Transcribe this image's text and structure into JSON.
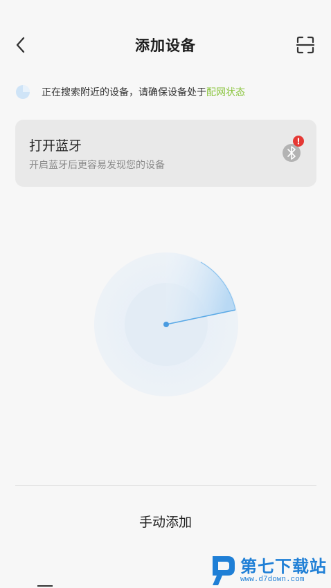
{
  "header": {
    "title": "添加设备",
    "back_icon": "chevron-left-icon",
    "scan_icon": "scan-icon"
  },
  "status": {
    "text": "正在搜索附近的设备，请确保设备处于",
    "link_text": "配网状态",
    "link_color": "#8bc53f",
    "indicator_icon": "searching-indicator-icon"
  },
  "bluetooth_card": {
    "title": "打开蓝牙",
    "subtitle": "开启蓝牙后更容易发现您的设备",
    "icon": "bluetooth-icon",
    "alert_icon": "alert-badge-icon",
    "alert_glyph": "!",
    "alert_color": "#e53935"
  },
  "radar": {
    "accent_color": "#5aa9e6"
  },
  "manual_add": {
    "label": "手动添加"
  },
  "watermark": {
    "brand": "第七下载站",
    "url": "www.d7down.com"
  }
}
